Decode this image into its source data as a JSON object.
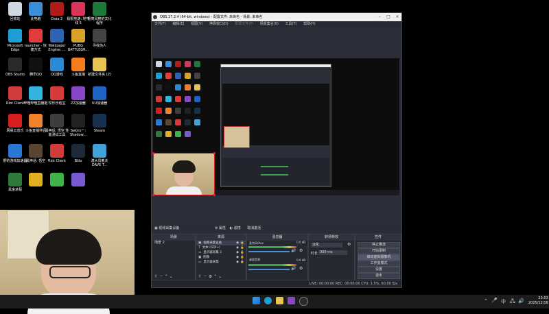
{
  "desktop": {
    "icons": [
      {
        "label": "回收站",
        "color": "#cfd8e2"
      },
      {
        "label": "此电脑",
        "color": "#3a8fd8"
      },
      {
        "label": "Dota 2",
        "color": "#b11b18"
      },
      {
        "label": "极限竞速: 地平线 5",
        "color": "#d9355a"
      },
      {
        "label": "极简风格的文化程序",
        "color": "#1c7a3a"
      },
      {
        "label": "Microsoft Edge",
        "color": "#1d9fd6"
      },
      {
        "label": "launcher - 快捷方式",
        "color": "#e23d3d"
      },
      {
        "label": "Wallpaper Engine: ...",
        "color": "#2e62b3"
      },
      {
        "label": "PUBG BATTLEGR...",
        "color": "#d7a12a"
      },
      {
        "label": "寻找伪人",
        "color": "#444"
      },
      {
        "label": "OBS Studio",
        "color": "#2a2a2a"
      },
      {
        "label": "腾讯QQ",
        "color": "#111"
      },
      {
        "label": "QQ游戏",
        "color": "#2a8ad6"
      },
      {
        "label": "斗鱼直播",
        "color": "#f57b1f"
      },
      {
        "label": "新建文件夹 (2)",
        "color": "#e6c452"
      },
      {
        "label": "Riot Client",
        "color": "#d23b3b"
      },
      {
        "label": "哔哩哔哩直播姬",
        "color": "#33b3e0"
      },
      {
        "label": "哎乐乐结宝",
        "color": "#d83a3a"
      },
      {
        "label": "ZZ加速器",
        "color": "#8a46c8"
      },
      {
        "label": "UU加速器",
        "color": "#1e64c4"
      },
      {
        "label": "网易云音乐",
        "color": "#d71f1f"
      },
      {
        "label": "斗鱼直播伴侣",
        "color": "#f0822a"
      },
      {
        "label": "黑神话: 悟空 性能测试工具",
        "color": "#3d3d3d"
      },
      {
        "label": "Sekiro™: Shadow...",
        "color": "#222"
      },
      {
        "label": "Steam",
        "color": "#17324f"
      },
      {
        "label": "野豹游戏加速器",
        "color": "#2a78d6"
      },
      {
        "label": "黑神话: 悟空",
        "color": "#5a4533"
      },
      {
        "label": "Riot Client",
        "color": "#d23b3b"
      },
      {
        "label": "Blitz",
        "color": "#1d2a3a"
      },
      {
        "label": "潜水员戴夫 DAVE T...",
        "color": "#3fa2d8"
      },
      {
        "label": "黑金进程",
        "color": "#2f7a3a"
      },
      {
        "label": "",
        "color": "#e0b022"
      },
      {
        "label": "",
        "color": "#3fb34a"
      },
      {
        "label": "",
        "color": "#7a5ad0"
      }
    ]
  },
  "obs": {
    "title": "OBS 27.2.4 (64-bit, windows) - 配置文件: 未命名 - 场景: 未命名",
    "menu": [
      "文件(F)",
      "编辑(E)",
      "视图(V)",
      "停靠窗口(D)",
      "配置文件(P)",
      "场景集合(S)",
      "工具(T)",
      "帮助(H)"
    ],
    "source_toolbar": {
      "selected": "视频采集设备",
      "props": "属性",
      "filters": "滤镜",
      "activate": "取消激活"
    },
    "docks": {
      "scenes": {
        "header": "场景",
        "items": [
          "场景 2"
        ]
      },
      "sources": {
        "header": "来源",
        "items": [
          "视频采集设备",
          "文本 (GDI+)",
          "显示器采集 2",
          "图像",
          "显示器采集"
        ]
      },
      "mixer": {
        "header": "混音器",
        "tracks": [
          {
            "name": "麦克风/Aux",
            "db": "0.0 dB"
          },
          {
            "name": "桌面音频",
            "db": "0.0 dB"
          }
        ]
      },
      "transitions": {
        "header": "转场特效",
        "type": "淡化",
        "duration_label": "时长",
        "duration": "300 ms"
      },
      "controls": {
        "header": "控件",
        "buttons": [
          "停止推流",
          "开始录制",
          "启动虚拟摄像机",
          "工作室模式",
          "设置",
          "退出"
        ]
      }
    },
    "status": "LIVE: 00:00:00   REC: 00:00:00   CPU: 1.5%, 60.00 fps"
  },
  "taskbar": {
    "time": "23:03",
    "date": "2025/12/18",
    "ime": "中"
  }
}
